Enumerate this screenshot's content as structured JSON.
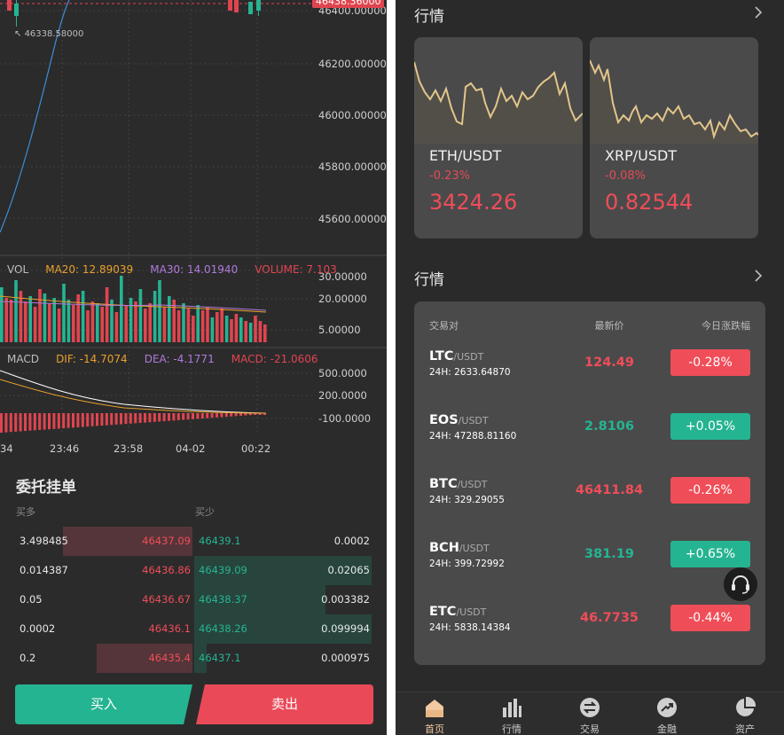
{
  "chart": {
    "price_tag": "46438.36000",
    "low_marker": "46338.58000",
    "price_axis": [
      "46400.00000",
      "46200.00000",
      "46000.00000",
      "45800.00000",
      "45600.00000"
    ],
    "vol_axis": [
      "30.00000",
      "20.00000",
      "5.00000"
    ],
    "macd_axis": [
      "500.0000",
      "200.0000",
      "-100.0000"
    ],
    "time_axis": [
      "34",
      "23:46",
      "23:58",
      "04-02",
      "00:22"
    ],
    "vol_legend": {
      "label": "VOL",
      "ma20": "MA20: 12.89039",
      "ma30": "MA30: 14.01940",
      "volume": "VOLUME: 7.103"
    },
    "macd_legend": {
      "label": "MACD",
      "dif": "DIF: -14.7074",
      "dea": "DEA: -4.1771",
      "macd": "MACD: -21.0606"
    },
    "colors": {
      "up": "#25b491",
      "down": "#e0454f",
      "ma20": "#e8a02a",
      "ma30": "#b07ad8",
      "volume_text": "#e0454f",
      "grid": "#454546"
    }
  },
  "order_book": {
    "title": "委托挂单",
    "buy_header": "买多",
    "sell_header": "买少",
    "rows": [
      {
        "buy_amount": "3.498485",
        "buy_price": "46437.09",
        "sell_price": "46439.1",
        "sell_amount": "0.0002",
        "buy_depth": 0.73,
        "sell_depth": 0.0
      },
      {
        "buy_amount": "0.014387",
        "buy_price": "46436.86",
        "sell_price": "46439.09",
        "sell_amount": "0.02065",
        "buy_depth": 0.0,
        "sell_depth": 1.0
      },
      {
        "buy_amount": "0.05",
        "buy_price": "46436.67",
        "sell_price": "46438.37",
        "sell_amount": "0.003382",
        "buy_depth": 0.0,
        "sell_depth": 0.74
      },
      {
        "buy_amount": "0.0002",
        "buy_price": "46436.1",
        "sell_price": "46438.26",
        "sell_amount": "0.099994",
        "buy_depth": 0.0,
        "sell_depth": 1.0
      },
      {
        "buy_amount": "0.2",
        "buy_price": "46435.4",
        "sell_price": "46437.1",
        "sell_amount": "0.000975",
        "buy_depth": 0.54,
        "sell_depth": 0.07
      }
    ]
  },
  "actions": {
    "buy": "买入",
    "sell": "卖出"
  },
  "market_cards": {
    "title": "行情",
    "cards": [
      {
        "pair": "ETH/USDT",
        "change": "-0.23%",
        "price": "3424.26"
      },
      {
        "pair": "XRP/USDT",
        "change": "-0.08%",
        "price": "0.82544"
      }
    ]
  },
  "market_table": {
    "title": "行情",
    "headers": {
      "pair": "交易对",
      "last": "最新价",
      "change": "今日涨跌幅"
    },
    "rows": [
      {
        "base": "LTC",
        "quote": "/USDT",
        "vol": "24H: 2633.64870",
        "last": "124.49",
        "change": "-0.28%",
        "dir": "down"
      },
      {
        "base": "EOS",
        "quote": "/USDT",
        "vol": "24H: 47288.81160",
        "last": "2.8106",
        "change": "+0.05%",
        "dir": "up"
      },
      {
        "base": "BTC",
        "quote": "/USDT",
        "vol": "24H: 329.29055",
        "last": "46411.84",
        "change": "-0.26%",
        "dir": "down"
      },
      {
        "base": "BCH",
        "quote": "/USDT",
        "vol": "24H: 399.72992",
        "last": "381.19",
        "change": "+0.65%",
        "dir": "up"
      },
      {
        "base": "ETC",
        "quote": "/USDT",
        "vol": "24H: 5838.14384",
        "last": "46.7735",
        "change": "-0.44%",
        "dir": "down"
      }
    ]
  },
  "tabbar": {
    "active": 0,
    "items": [
      {
        "label": "首页",
        "icon": "home-icon"
      },
      {
        "label": "行情",
        "icon": "bar-chart-icon"
      },
      {
        "label": "交易",
        "icon": "exchange-icon"
      },
      {
        "label": "金融",
        "icon": "trend-icon"
      },
      {
        "label": "资产",
        "icon": "pie-chart-icon"
      }
    ]
  }
}
